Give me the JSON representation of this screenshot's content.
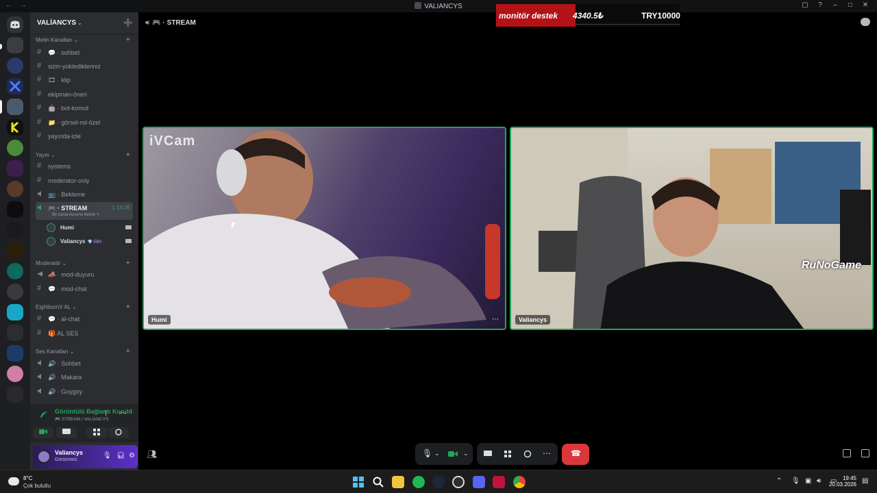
{
  "window": {
    "title": "VALIANCYS",
    "nav": "← →",
    "controls": [
      "▢",
      "?",
      "–",
      "□",
      "✕"
    ]
  },
  "ticker": {
    "label": "monitör destek",
    "amount": "4340.5₺",
    "code": "TRY10000"
  },
  "guild": {
    "name": "VALİANCYS",
    "chevron": "⌄",
    "invite_icon": "➕"
  },
  "categories": {
    "text": "Metin Kanalları ⌄",
    "broadcast": "Yayın ⌄",
    "moderator": "Moderatör ⌄",
    "eighthborn": "EightbornV AL ⌄",
    "voice": "Ses Kanalları ⌄",
    "plus": "+"
  },
  "channels": {
    "sohbet": "💬 · sohbet",
    "yuklediklerin": "sizin-yükledikleriniz",
    "klip": "🎞 · klip",
    "ekipman": "ekipman-öneri",
    "botkomut": "🤖 · bot-komut",
    "gorsel": "📁 · görsel-rol-özel",
    "yayinda": "yayında-izle",
    "systems": "systems",
    "modonly": "moderator-only",
    "bekleme": "📺 · Bekleme",
    "stream": "🎮 · STREAM",
    "stream_time": "1:14:35",
    "stream_status": "Bir kanal durumu belirle ✎",
    "modduyuru": "📣 · mod-duyuru",
    "modchat": "💬 · mod-chat",
    "alchat": "💬 · al-chat",
    "alses": "🎁 AL SES",
    "vsohbet": "🔊 · Sohbet",
    "makara": "🔊 · Makara",
    "goygoy": "🔊 · Goygoy"
  },
  "voice_users": [
    {
      "name": "Humi",
      "badge": ""
    },
    {
      "name": "Valiancys",
      "badge": "💎 EBV"
    }
  ],
  "voice_panel": {
    "status": "Görüntülü Bağlantı Kuruld",
    "location": "🎮 STREAM / VALİANCYS"
  },
  "user_panel": {
    "name": "Valiancys",
    "status": "Görünmez"
  },
  "main": {
    "header": "🎮 · STREAM"
  },
  "tiles": [
    {
      "name": "Humi",
      "watermark": "iVCam"
    },
    {
      "name": "Valiancys",
      "logo": "RuNoGame"
    }
  ],
  "taskbar": {
    "temp": "8°C",
    "weather": "Çok bulutlu",
    "time": "19:45",
    "date": "20.03.2026"
  }
}
